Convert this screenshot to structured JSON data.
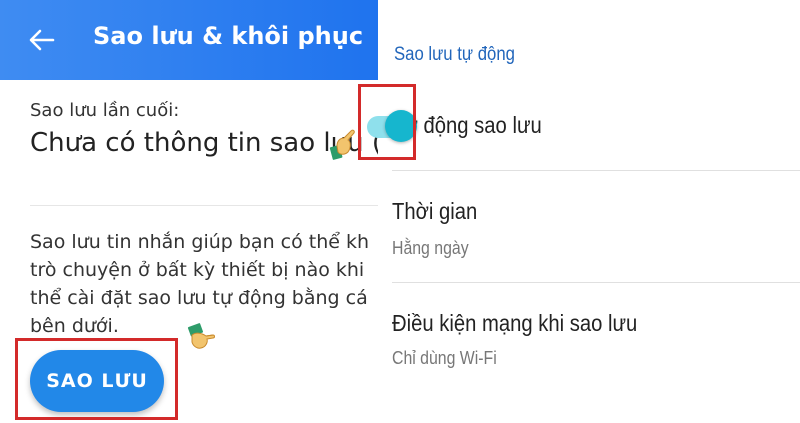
{
  "left_screen": {
    "header": {
      "title": "Sao lưu & khôi phục",
      "background": "#2d7ff0"
    },
    "last_backup": {
      "label": "Sao lưu lần cuối:",
      "value": "Chưa có thông tin sao lưu ("
    },
    "description_lines": [
      "Sao lưu tin nhắn giúp bạn có thể kh",
      "trò chuyện ở bất kỳ thiết bị nào khi",
      "thể cài đặt sao lưu tự động bằng cá",
      "bên dưới."
    ],
    "backup_button": {
      "label": "SAO LƯU",
      "color": "#2288e8"
    },
    "highlight_color": "#d32a2a"
  },
  "right_screen": {
    "section_title": "Sao lưu tự động",
    "auto_backup": {
      "title": "Tự động sao lưu",
      "enabled": true,
      "accent": "#16b6ce"
    },
    "time": {
      "title": "Thời gian",
      "value": "Hằng ngày"
    },
    "network": {
      "title": "Điều kiện mạng khi sao lưu",
      "value": "Chỉ dùng Wi-Fi"
    }
  },
  "icons": {
    "back": "arrow-left-icon",
    "pointer": "pointing-hand-icon"
  }
}
